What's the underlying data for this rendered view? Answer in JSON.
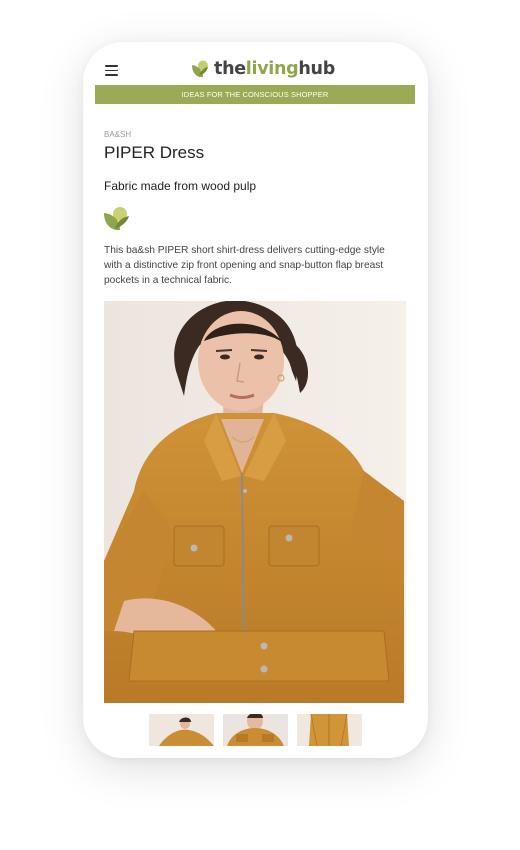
{
  "header": {
    "logo": {
      "part1": "the",
      "part2": "living",
      "part3": "hub"
    },
    "banner_text": "IDEAS FOR THE CONSCIOUS SHOPPER"
  },
  "product": {
    "brand": "BA&SH",
    "title": "PIPER Dress",
    "subtitle": "Fabric made from wood pulp",
    "description": "This ba&sh PIPER short shirt-dress delivers cutting-edge style with a distinctive zip front opening and snap-button flap breast pockets in a technical fabric."
  },
  "icons": {
    "menu": "hamburger-menu-icon",
    "logo_mark": "leaf-logo-icon",
    "fabric_badge": "leaf-badge-icon"
  },
  "gallery": {
    "thumbnail_count": 3
  },
  "colors": {
    "brand_green": "#9aaa55",
    "logo_green": "#8fa64c",
    "dress": "#c98d33",
    "text_dark": "#222222"
  }
}
